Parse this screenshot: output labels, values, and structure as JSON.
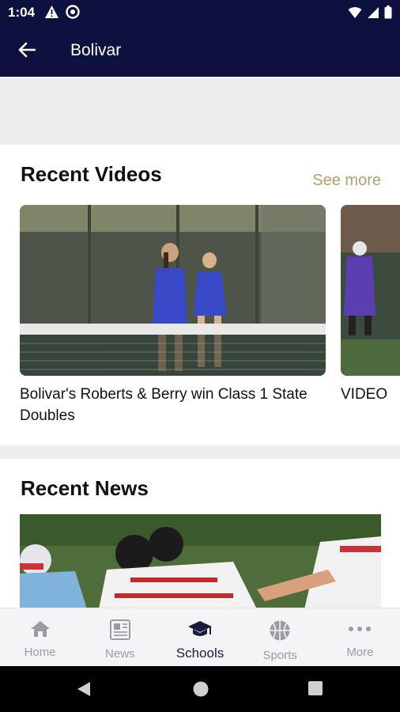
{
  "status_bar": {
    "time": "1:04",
    "icons": [
      "warning-icon",
      "sync-icon",
      "wifi-icon",
      "signal-icon",
      "battery-icon"
    ]
  },
  "app_bar": {
    "title": "Bolivar",
    "back_icon": "arrow-back-icon"
  },
  "recent_videos": {
    "title": "Recent Videos",
    "see_more": "See more",
    "items": [
      {
        "caption": "Bolivar's Roberts & Berry win Class 1 State Doubles"
      },
      {
        "caption": "VIDEO"
      }
    ]
  },
  "recent_news": {
    "title": "Recent News"
  },
  "bottom_nav": {
    "items": [
      {
        "label": "Home",
        "icon": "home-icon"
      },
      {
        "label": "News",
        "icon": "newspaper-icon"
      },
      {
        "label": "Schools",
        "icon": "graduation-cap-icon",
        "active": true
      },
      {
        "label": "Sports",
        "icon": "basketball-icon"
      },
      {
        "label": "More",
        "icon": "more-dots-icon"
      }
    ]
  },
  "colors": {
    "header": "#0e1140",
    "accent_gold": "#b2a06a",
    "nav_active": "#1a1d3d",
    "nav_inactive": "#9a9ca3"
  }
}
